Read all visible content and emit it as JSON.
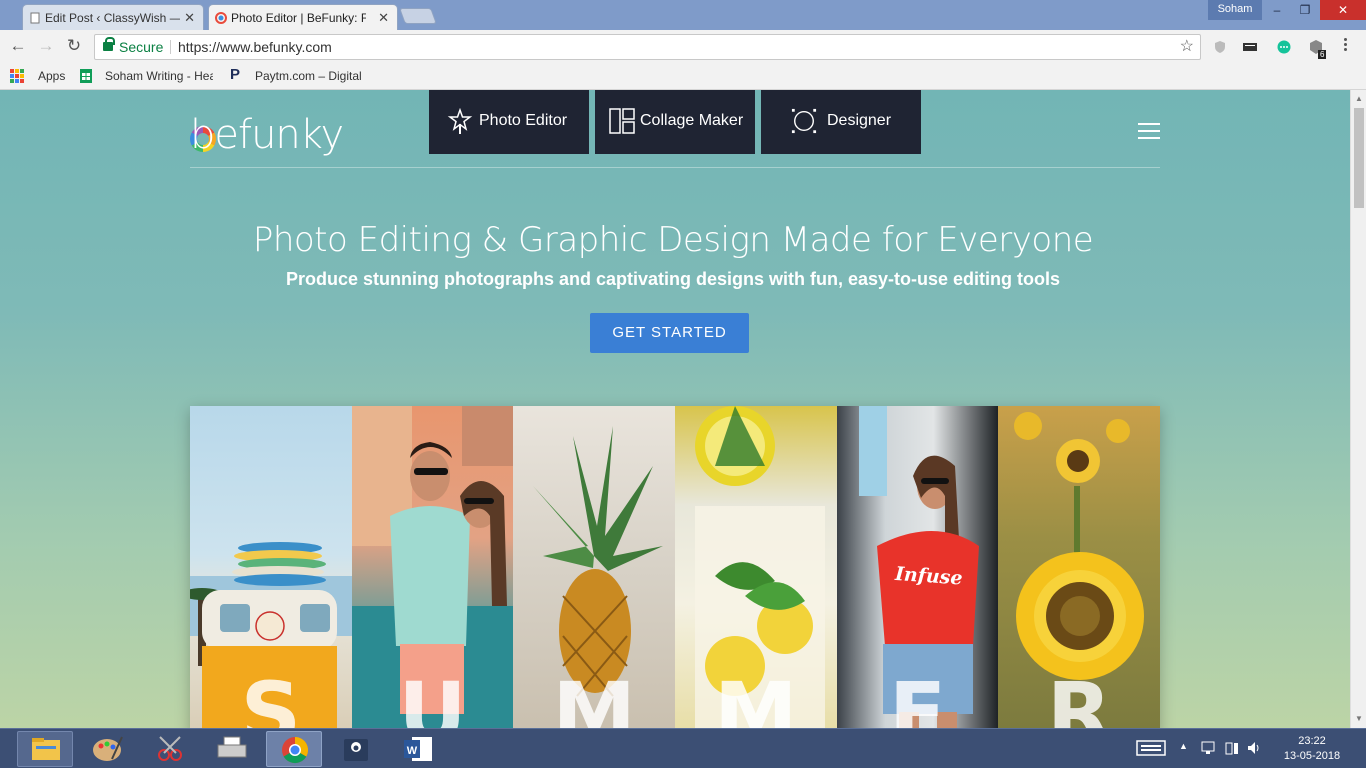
{
  "browser": {
    "tabs": [
      {
        "title": "Edit Post ‹ ClassyWish —",
        "active": false
      },
      {
        "title": "Photo Editor | BeFunky: Fr",
        "active": true
      }
    ],
    "profile": "Soham",
    "window_controls": [
      "–",
      "❐",
      "✕"
    ],
    "nav": {
      "back": "←",
      "forward": "→",
      "reload": "↻"
    },
    "address": {
      "secure_label": "Secure",
      "url": "https://www.befunky.com"
    },
    "extension_badge": "6"
  },
  "bookmarks": [
    {
      "label": "Apps",
      "icon": "apps-grid-icon"
    },
    {
      "label": "Soham Writing - Hea",
      "icon": "google-sheets-icon"
    },
    {
      "label": "Paytm.com – Digital",
      "icon": "paytm-icon"
    }
  ],
  "site": {
    "logo_text": "befunky",
    "nav_tabs": [
      {
        "label": "Photo Editor",
        "icon": "star-wand-icon"
      },
      {
        "label": "Collage Maker",
        "icon": "collage-grid-icon"
      },
      {
        "label": "Designer",
        "icon": "designer-circle-icon"
      }
    ],
    "hero": {
      "title": "Photo Editing & Graphic Design Made for Everyone",
      "subtitle": "Produce stunning photographs and captivating designs with fun, easy-to-use editing tools",
      "cta": "GET STARTED"
    },
    "strip_letters": [
      "S",
      "U",
      "M",
      "M",
      "E",
      "R"
    ],
    "shirt_text": "Infuse"
  },
  "taskbar": {
    "apps": [
      "file-explorer-icon",
      "paint-icon",
      "snipping-tool-icon",
      "scanner-icon",
      "chrome-icon",
      "app-icon",
      "word-icon"
    ],
    "clock_time": "23:22",
    "clock_date": "13-05-2018"
  },
  "colors": {
    "page_teal": "#72b5b5",
    "nav_dark": "#1f2433",
    "cta_blue": "#3a7fd5",
    "secure_green": "#0b8043"
  }
}
